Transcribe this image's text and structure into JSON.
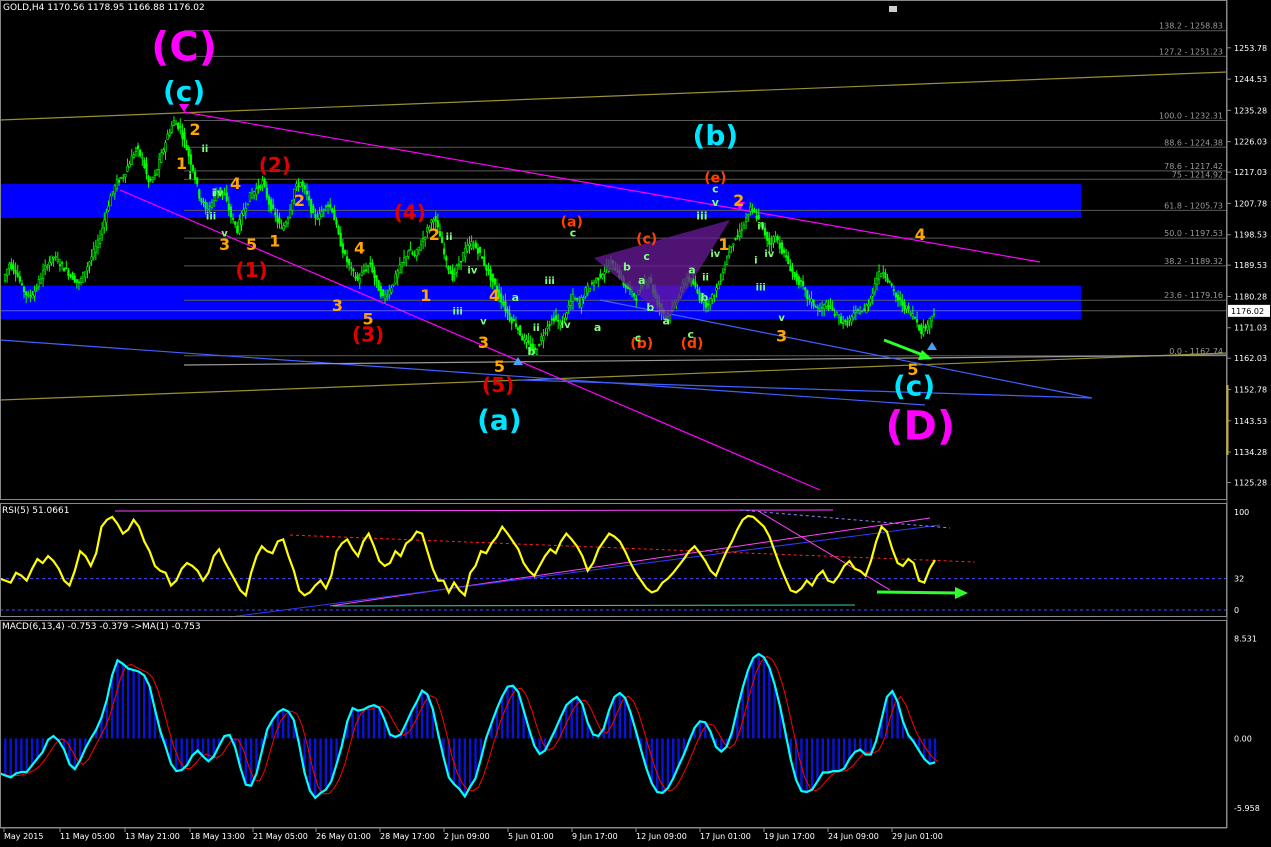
{
  "window": {
    "symbol_line": "GOLD,H4  1170.56 1178.95 1166.88 1176.02",
    "rsi_line": "RSI(5) 51.0661",
    "macd_line": "MACD(6,13,4) -0.753 -0.379  ->MA(1) -0.753"
  },
  "colors": {
    "bull": "#00ff00",
    "bear": "#00ff00",
    "zone": "#0000ff",
    "trend_magenta": "#ff00ff",
    "trend_olive": "#9a8f2e",
    "trend_blue": "#4060ff",
    "rsi": "#ffff00",
    "macd_hist": "#0a14d8",
    "macd_line": "#00ffff",
    "macd_signal": "#ff0000",
    "current_price_bg": "#ffffff"
  },
  "chart_data": [
    {
      "type": "candlestick",
      "title": "GOLD,H4",
      "price_axis": [
        "1253.78",
        "1244.53",
        "1235.28",
        "1226.03",
        "1217.03",
        "1207.78",
        "1198.53",
        "1189.53",
        "1180.28",
        "1171.03",
        "1162.03",
        "1152.78",
        "1143.53",
        "1134.28",
        "1125.28"
      ],
      "current_price": "1176.02",
      "ylim": [
        1121,
        1262
      ],
      "time_axis": [
        "May 2015",
        "11 May 05:00",
        "13 May 21:00",
        "18 May 13:00",
        "21 May 05:00",
        "26 May 01:00",
        "28 May 17:00",
        "2 Jun 09:00",
        "5 Jun 01:00",
        "9 Jun 17:00",
        "12 Jun 09:00",
        "17 Jun 01:00",
        "19 Jun 17:00",
        "24 Jun 09:00",
        "29 Jun 01:00"
      ],
      "fib_levels": [
        {
          "label": "138.2 - 1258.83",
          "value": 1258.83
        },
        {
          "label": "127.2 - 1251.23",
          "value": 1251.23
        },
        {
          "label": "100.0 - 1232.31",
          "value": 1232.31
        },
        {
          "label": "88.6 - 1224.38",
          "value": 1224.38
        },
        {
          "label": "78.6 - 1217.42",
          "value": 1217.42
        },
        {
          "label": "75 - 1214.92",
          "value": 1214.92
        },
        {
          "label": "61.8 - 1205.73",
          "value": 1205.73
        },
        {
          "label": "50.0 - 1197.53",
          "value": 1197.53
        },
        {
          "label": "38.2 - 1189.32",
          "value": 1189.32
        },
        {
          "label": "23.6 - 1179.16",
          "value": 1179.16
        },
        {
          "label": "0.0 - 1162.74",
          "value": 1162.74
        }
      ],
      "zones": [
        {
          "from": 1203.5,
          "to": 1213.5
        },
        {
          "from": 1173.5,
          "to": 1183.5
        }
      ],
      "price_path": [
        1185,
        1190,
        1188,
        1183,
        1180,
        1182,
        1186,
        1190,
        1192,
        1190,
        1188,
        1186,
        1184,
        1188,
        1192,
        1196,
        1203,
        1210,
        1214,
        1216,
        1220,
        1224,
        1221,
        1214,
        1216,
        1222,
        1228,
        1232,
        1230,
        1224,
        1218,
        1210,
        1206,
        1208,
        1212,
        1210,
        1204,
        1200,
        1206,
        1210,
        1212,
        1214,
        1208,
        1204,
        1200,
        1204,
        1212,
        1214,
        1210,
        1204,
        1204,
        1208,
        1206,
        1198,
        1192,
        1188,
        1185,
        1188,
        1190,
        1184,
        1180,
        1182,
        1186,
        1190,
        1194,
        1192,
        1196,
        1200,
        1204,
        1198,
        1190,
        1186,
        1190,
        1194,
        1196,
        1194,
        1190,
        1186,
        1182,
        1178,
        1174,
        1172,
        1168,
        1166,
        1164,
        1168,
        1172,
        1174,
        1172,
        1176,
        1180,
        1178,
        1182,
        1184,
        1186,
        1188,
        1190,
        1188,
        1184,
        1182,
        1180,
        1184,
        1186,
        1180,
        1176,
        1174,
        1178,
        1182,
        1186,
        1184,
        1180,
        1178,
        1180,
        1184,
        1190,
        1196,
        1198,
        1202,
        1206,
        1204,
        1200,
        1196,
        1198,
        1194,
        1190,
        1186,
        1184,
        1180,
        1178,
        1176,
        1178,
        1176,
        1174,
        1172,
        1174,
        1176,
        1176,
        1180,
        1186,
        1188,
        1184,
        1180,
        1178,
        1176,
        1174,
        1170,
        1172,
        1176
      ],
      "wave_labels": [
        {
          "t": "(C)",
          "color": "#ff00ff",
          "size": 40,
          "x": 0.15,
          "p": 1250
        },
        {
          "t": "(c)",
          "color": "#00e5ff",
          "size": 28,
          "x": 0.15,
          "p": 1238
        },
        {
          "t": "(D)",
          "color": "#ff00ff",
          "size": 40,
          "x": 0.75,
          "p": 1138
        },
        {
          "t": "(c)",
          "color": "#00e5ff",
          "size": 28,
          "x": 0.745,
          "p": 1151
        },
        {
          "t": "(b)",
          "color": "#00e5ff",
          "size": 28,
          "x": 0.583,
          "p": 1225
        },
        {
          "t": "(a)",
          "color": "#00e5ff",
          "size": 28,
          "x": 0.407,
          "p": 1141
        },
        {
          "t": "(e)",
          "color": "#ff4000",
          "size": 14,
          "x": 0.583,
          "p": 1214
        },
        {
          "t": "(1)",
          "color": "#e00000",
          "size": 20,
          "x": 0.205,
          "p": 1186
        },
        {
          "t": "(2)",
          "color": "#e00000",
          "size": 20,
          "x": 0.224,
          "p": 1217
        },
        {
          "t": "(3)",
          "color": "#e00000",
          "size": 20,
          "x": 0.3,
          "p": 1167
        },
        {
          "t": "(4)",
          "color": "#e00000",
          "size": 20,
          "x": 0.334,
          "p": 1203
        },
        {
          "t": "(5)",
          "color": "#e00000",
          "size": 20,
          "x": 0.406,
          "p": 1152
        },
        {
          "t": "(a)",
          "color": "#ff4000",
          "size": 14,
          "x": 0.466,
          "p": 1201
        },
        {
          "t": "(b)",
          "color": "#ff4000",
          "size": 14,
          "x": 0.523,
          "p": 1165
        },
        {
          "t": "(c)",
          "color": "#ff4000",
          "size": 14,
          "x": 0.527,
          "p": 1196
        },
        {
          "t": "(d)",
          "color": "#ff4000",
          "size": 14,
          "x": 0.564,
          "p": 1165
        },
        {
          "t": "2",
          "color": "#ffa500",
          "size": 16,
          "x": 0.159,
          "p": 1228
        },
        {
          "t": "1",
          "color": "#ffa500",
          "size": 16,
          "x": 0.148,
          "p": 1218
        },
        {
          "t": "4",
          "color": "#ffa500",
          "size": 16,
          "x": 0.192,
          "p": 1212
        },
        {
          "t": "3",
          "color": "#ffa500",
          "size": 16,
          "x": 0.183,
          "p": 1194
        },
        {
          "t": "5",
          "color": "#ffa500",
          "size": 16,
          "x": 0.205,
          "p": 1194
        },
        {
          "t": "1",
          "color": "#ffa500",
          "size": 16,
          "x": 0.224,
          "p": 1195
        },
        {
          "t": "2",
          "color": "#ffa500",
          "size": 16,
          "x": 0.244,
          "p": 1207
        },
        {
          "t": "4",
          "color": "#ffa500",
          "size": 16,
          "x": 0.293,
          "p": 1193
        },
        {
          "t": "3",
          "color": "#ffa500",
          "size": 16,
          "x": 0.275,
          "p": 1176
        },
        {
          "t": "5",
          "color": "#ffa500",
          "size": 16,
          "x": 0.3,
          "p": 1172
        },
        {
          "t": "2",
          "color": "#ffa500",
          "size": 16,
          "x": 0.354,
          "p": 1197
        },
        {
          "t": "1",
          "color": "#ffa500",
          "size": 16,
          "x": 0.347,
          "p": 1179
        },
        {
          "t": "4",
          "color": "#ffa500",
          "size": 16,
          "x": 0.403,
          "p": 1179
        },
        {
          "t": "3",
          "color": "#ffa500",
          "size": 16,
          "x": 0.394,
          "p": 1165
        },
        {
          "t": "5",
          "color": "#ffa500",
          "size": 16,
          "x": 0.407,
          "p": 1158
        },
        {
          "t": "2",
          "color": "#ffa500",
          "size": 16,
          "x": 0.602,
          "p": 1207
        },
        {
          "t": "1",
          "color": "#ffa500",
          "size": 16,
          "x": 0.59,
          "p": 1194
        },
        {
          "t": "3",
          "color": "#ffa500",
          "size": 16,
          "x": 0.637,
          "p": 1167
        },
        {
          "t": "4",
          "color": "#ffa500",
          "size": 16,
          "x": 0.75,
          "p": 1197
        },
        {
          "t": "5",
          "color": "#ffa500",
          "size": 16,
          "x": 0.744,
          "p": 1157
        },
        {
          "t": "c",
          "color": "#7fff7f",
          "size": 11,
          "x": 0.583,
          "p": 1211
        },
        {
          "t": "v",
          "color": "#7fff7f",
          "size": 11,
          "x": 0.583,
          "p": 1207
        },
        {
          "t": "iii",
          "color": "#7fff7f",
          "size": 11,
          "x": 0.572,
          "p": 1203
        },
        {
          "t": "a",
          "color": "#7fff7f",
          "size": 11,
          "x": 0.564,
          "p": 1187
        },
        {
          "t": "b",
          "color": "#7fff7f",
          "size": 11,
          "x": 0.574,
          "p": 1179
        },
        {
          "t": "b",
          "color": "#7fff7f",
          "size": 11,
          "x": 0.511,
          "p": 1188
        },
        {
          "t": "a",
          "color": "#7fff7f",
          "size": 11,
          "x": 0.523,
          "p": 1184
        },
        {
          "t": "c",
          "color": "#7fff7f",
          "size": 11,
          "x": 0.527,
          "p": 1191
        },
        {
          "t": "b",
          "color": "#7fff7f",
          "size": 11,
          "x": 0.53,
          "p": 1176
        },
        {
          "t": "a",
          "color": "#7fff7f",
          "size": 11,
          "x": 0.543,
          "p": 1172
        },
        {
          "t": "c",
          "color": "#7fff7f",
          "size": 11,
          "x": 0.563,
          "p": 1168
        },
        {
          "t": "c",
          "color": "#7fff7f",
          "size": 11,
          "x": 0.52,
          "p": 1167
        },
        {
          "t": "a",
          "color": "#7fff7f",
          "size": 11,
          "x": 0.487,
          "p": 1170
        },
        {
          "t": "b",
          "color": "#7fff7f",
          "size": 11,
          "x": 0.433,
          "p": 1163
        },
        {
          "t": "a",
          "color": "#7fff7f",
          "size": 11,
          "x": 0.42,
          "p": 1179
        },
        {
          "t": "c",
          "color": "#7fff7f",
          "size": 11,
          "x": 0.467,
          "p": 1198
        },
        {
          "t": "iv",
          "color": "#7fff7f",
          "size": 10,
          "x": 0.461,
          "p": 1171
        },
        {
          "t": "iii",
          "color": "#7fff7f",
          "size": 10,
          "x": 0.448,
          "p": 1184
        },
        {
          "t": "ii",
          "color": "#7fff7f",
          "size": 10,
          "x": 0.437,
          "p": 1170
        },
        {
          "t": "iv",
          "color": "#7fff7f",
          "size": 10,
          "x": 0.385,
          "p": 1187
        },
        {
          "t": "iii",
          "color": "#7fff7f",
          "size": 10,
          "x": 0.373,
          "p": 1175
        },
        {
          "t": "ii",
          "color": "#7fff7f",
          "size": 10,
          "x": 0.366,
          "p": 1197
        },
        {
          "t": "v",
          "color": "#7fff7f",
          "size": 10,
          "x": 0.394,
          "p": 1172
        },
        {
          "t": "ii",
          "color": "#7fff7f",
          "size": 10,
          "x": 0.62,
          "p": 1200
        },
        {
          "t": "iv",
          "color": "#7fff7f",
          "size": 10,
          "x": 0.627,
          "p": 1192
        },
        {
          "t": "iii",
          "color": "#7fff7f",
          "size": 10,
          "x": 0.62,
          "p": 1182
        },
        {
          "t": "v",
          "color": "#7fff7f",
          "size": 10,
          "x": 0.637,
          "p": 1173
        },
        {
          "t": "iv",
          "color": "#7fff7f",
          "size": 10,
          "x": 0.583,
          "p": 1192
        },
        {
          "t": "ii",
          "color": "#7fff7f",
          "size": 10,
          "x": 0.575,
          "p": 1185
        },
        {
          "t": "i",
          "color": "#7fff7f",
          "size": 10,
          "x": 0.616,
          "p": 1190
        },
        {
          "t": "iii",
          "color": "#7fff7f",
          "size": 10,
          "x": 0.172,
          "p": 1203
        },
        {
          "t": "ii",
          "color": "#7fff7f",
          "size": 10,
          "x": 0.167,
          "p": 1223
        },
        {
          "t": "i",
          "color": "#7fff7f",
          "size": 10,
          "x": 0.155,
          "p": 1215
        },
        {
          "t": "iv",
          "color": "#7fff7f",
          "size": 10,
          "x": 0.178,
          "p": 1210
        },
        {
          "t": "v",
          "color": "#7fff7f",
          "size": 10,
          "x": 0.183,
          "p": 1198
        },
        {
          "t": "i",
          "color": "#7fff7f",
          "size": 10,
          "x": 0.174,
          "p": 1210
        }
      ]
    },
    {
      "type": "line",
      "title": "RSI(5) 51.0661",
      "axis": [
        "100",
        "32",
        "0"
      ],
      "series": [
        {
          "name": "RSI(5)",
          "values": [
            32,
            30,
            28,
            38,
            35,
            30,
            42,
            52,
            48,
            55,
            50,
            42,
            30,
            25,
            40,
            60,
            55,
            45,
            58,
            85,
            92,
            95,
            88,
            78,
            82,
            92,
            85,
            70,
            60,
            45,
            40,
            38,
            25,
            30,
            42,
            48,
            45,
            40,
            30,
            38,
            55,
            62,
            50,
            40,
            30,
            20,
            15,
            38,
            55,
            65,
            60,
            58,
            70,
            72,
            55,
            40,
            20,
            15,
            18,
            25,
            30,
            22,
            35,
            60,
            68,
            72,
            62,
            55,
            70,
            78,
            65,
            50,
            45,
            48,
            60,
            55,
            68,
            72,
            80,
            78,
            60,
            42,
            30,
            30,
            18,
            28,
            20,
            15,
            38,
            45,
            60,
            58,
            68,
            75,
            85,
            78,
            70,
            62,
            48,
            40,
            35,
            45,
            55,
            62,
            58,
            70,
            78,
            72,
            65,
            55,
            40,
            48,
            62,
            70,
            78,
            75,
            70,
            60,
            48,
            38,
            30,
            22,
            18,
            20,
            28,
            32,
            38,
            45,
            52,
            60,
            65,
            58,
            50,
            40,
            35,
            48,
            60,
            70,
            82,
            92,
            96,
            95,
            90,
            85,
            75,
            60,
            45,
            32,
            20,
            18,
            22,
            30,
            25,
            35,
            40,
            30,
            28,
            35,
            45,
            50,
            42,
            40,
            35,
            50,
            70,
            85,
            80,
            62,
            48,
            45,
            52,
            48,
            30,
            28,
            42,
            51
          ]
        }
      ],
      "ylim": [
        0,
        100
      ]
    },
    {
      "type": "bar+line",
      "title": "MACD(6,13,4) -0.753 -0.379  ->MA(1) -0.753",
      "axis": [
        "8.531",
        "0.00",
        "-5.958"
      ],
      "ylim": [
        -6.8,
        9.6
      ]
    }
  ]
}
